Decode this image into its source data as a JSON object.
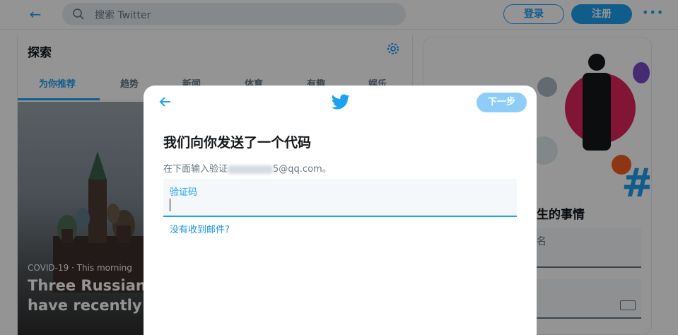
{
  "topbar": {
    "search_placeholder": "搜索 Twitter",
    "login_label": "登录",
    "signup_label": "注册",
    "more_label": "•••",
    "back_icon": "back-arrow-icon",
    "search_icon": "search-icon"
  },
  "explore": {
    "title": "探索",
    "settings_icon": "gear-icon",
    "tabs": [
      {
        "label": "为你推荐",
        "active": true
      },
      {
        "label": "趋势",
        "active": false
      },
      {
        "label": "新闻",
        "active": false
      },
      {
        "label": "体育",
        "active": false
      },
      {
        "label": "有趣",
        "active": false
      },
      {
        "label": "娱乐",
        "active": false
      }
    ],
    "hero": {
      "meta": "COVID-19 · This morning",
      "title_line1": "Three Russian d",
      "title_line2": "have recently fa"
    }
  },
  "sidebar": {
    "heading_partial": "生的事情",
    "field1_partial": "名",
    "keyboard_icon": "keyboard-icon"
  },
  "modal": {
    "next_label": "下一步",
    "title": "我们向你发送了一个代码",
    "subtitle_prefix": "在下面输入验证",
    "subtitle_suffix": "5@qq.com。",
    "input_label": "验证码",
    "input_value": "",
    "resend_link": "没有收到邮件?",
    "colors": {
      "accent": "#1da1f2",
      "next_disabled": "#8ecdf7"
    }
  }
}
